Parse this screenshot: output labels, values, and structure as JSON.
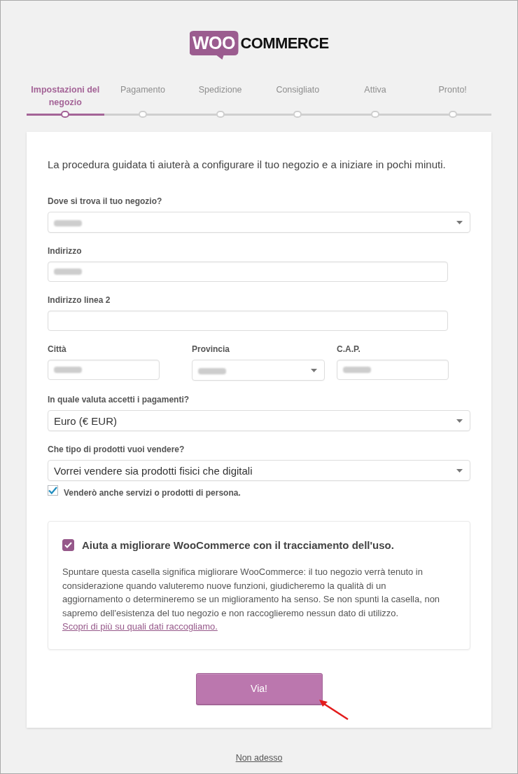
{
  "logo": {
    "badge": "WOO",
    "wordmark": "COMMERCE"
  },
  "steps": [
    {
      "label": "Impostazioni del negozio",
      "selected": true
    },
    {
      "label": "Pagamento",
      "selected": false
    },
    {
      "label": "Spedizione",
      "selected": false
    },
    {
      "label": "Consigliato",
      "selected": false
    },
    {
      "label": "Attiva",
      "selected": false
    },
    {
      "label": "Pronto!",
      "selected": false
    }
  ],
  "form": {
    "intro": "La procedura guidata ti aiuterà a configurare il tuo negozio e a iniziare in pochi minuti.",
    "fields": [
      {
        "kind": "select",
        "label": "Dove si trova il tuo negozio?",
        "redacted": true
      },
      {
        "kind": "input",
        "label": "Indirizzo",
        "redacted": true
      },
      {
        "kind": "input",
        "label": "Indirizzo linea 2",
        "redacted": false
      }
    ],
    "location_row": [
      {
        "kind": "input",
        "label": "Città",
        "redacted": true
      },
      {
        "kind": "select",
        "label": "Provincia",
        "redacted": true
      },
      {
        "kind": "input",
        "label": "C.A.P.",
        "redacted": true
      }
    ],
    "settings": [
      {
        "kind": "select",
        "label": "In quale valuta accetti i pagamenti?",
        "value": "Euro (€ EUR)",
        "redacted": false
      },
      {
        "kind": "select",
        "label": "Che tipo di prodotti vuoi vendere?",
        "value": "Vorrei vendere sia prodotti fisici che digitali",
        "redacted": false
      }
    ],
    "option": {
      "label": "Venderò anche servizi o prodotti di persona.",
      "checked": true
    }
  },
  "tracking": {
    "checked": true,
    "heading": "Aiuta a migliorare WooCommerce con il tracciamento dell'uso.",
    "description": "Spuntare questa casella significa migliorare WooCommerce: il tuo negozio verrà tenuto in considerazione quando valuteremo nuove funzioni, giudicheremo la qualità di un aggiornamento o determineremo se un miglioramento ha senso. Se non spunti la casella, non sapremo dell'esistenza del tuo negozio e non raccoglieremo nessun dato di utilizzo.",
    "link": "Scopri di più su quali dati raccogliamo."
  },
  "submit_button": "Via!",
  "skip_link": "Non adesso"
}
